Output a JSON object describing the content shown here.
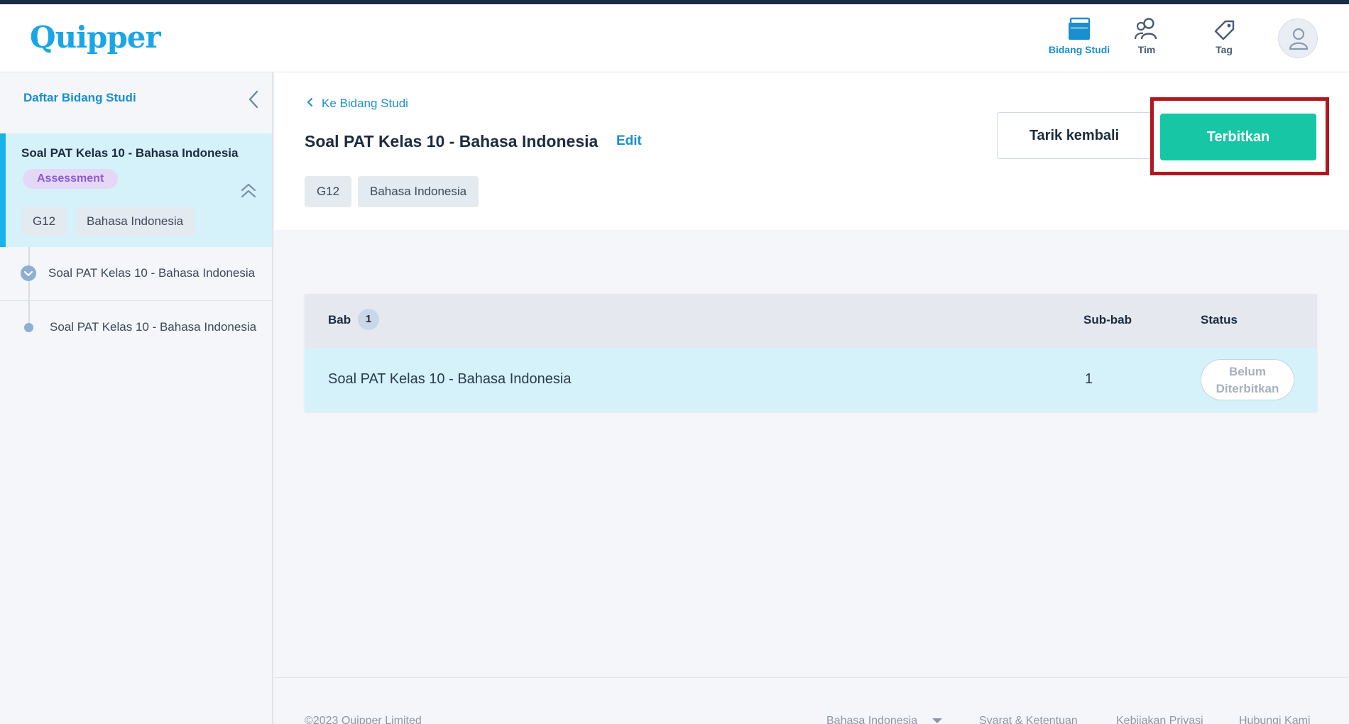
{
  "header": {
    "logo": "Quipper",
    "nav": [
      {
        "label": "Bidang Studi",
        "icon": "book-icon"
      },
      {
        "label": "Tim",
        "icon": "team-icon"
      },
      {
        "label": "Tag",
        "icon": "tag-icon"
      }
    ],
    "colors": {
      "accent": "#1a8fd0",
      "brand": "#1aa6e6"
    }
  },
  "sidebar": {
    "title": "Daftar Bidang Studi",
    "card": {
      "title": "Soal PAT Kelas 10 - Bahasa Indonesia",
      "badge": "Assessment",
      "tags": [
        "G12",
        "Bahasa Indonesia"
      ]
    },
    "items": [
      {
        "label": "Soal PAT Kelas 10 - Bahasa Indonesia"
      },
      {
        "label": "Soal PAT Kelas 10 - Bahasa Indonesia"
      }
    ]
  },
  "main": {
    "back_label": "Ke Bidang Studi",
    "title": "Soal PAT Kelas 10 - Bahasa Indonesia",
    "edit_label": "Edit",
    "tags": [
      "G12",
      "Bahasa Indonesia"
    ],
    "btn_tarik": "Tarik kembali",
    "btn_terbit": "Terbitkan",
    "colors": {
      "publish": "#16c6a5",
      "highlight": "#b0181f"
    }
  },
  "table": {
    "headers": {
      "bab": "Bab",
      "count": "1",
      "subbab": "Sub-bab",
      "status": "Status"
    },
    "rows": [
      {
        "title": "Soal PAT Kelas 10 - Bahasa Indonesia",
        "subbab": "1",
        "status_line1": "Belum",
        "status_line2": "Diterbitkan"
      }
    ]
  },
  "footer": {
    "copyright": "©2023 Quipper Limited",
    "language": "Bahasa Indonesia",
    "links": [
      "Syarat & Ketentuan",
      "Kebijakan Privasi",
      "Hubungi Kami"
    ]
  }
}
